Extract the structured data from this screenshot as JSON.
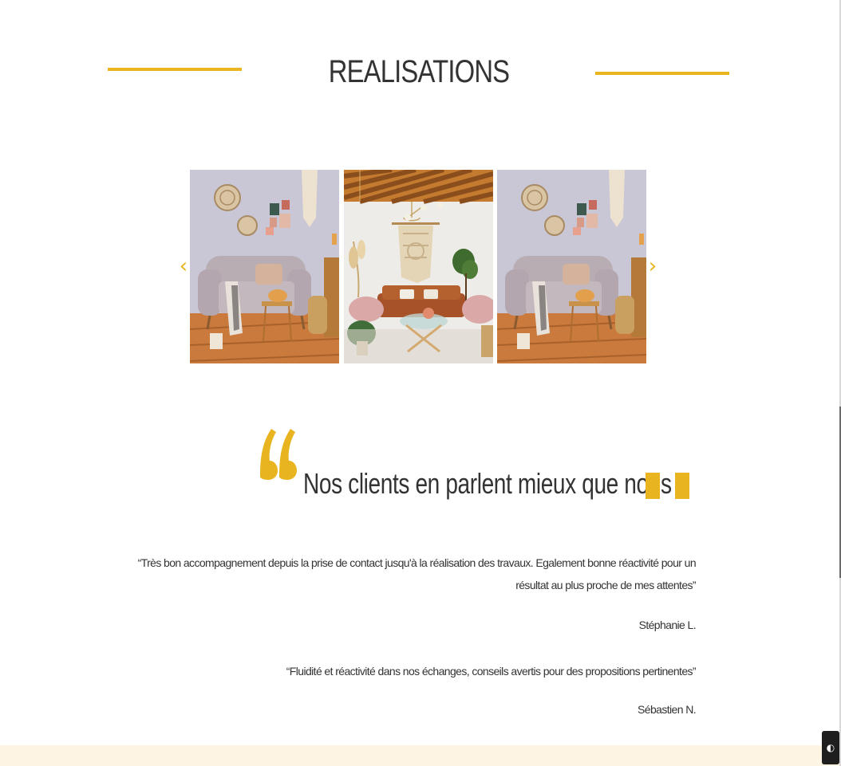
{
  "section": {
    "title": "REALISATIONS"
  },
  "carousel": {
    "prev_icon": "chevron-left-icon",
    "next_icon": "chevron-right-icon",
    "prev_glyph": "‹",
    "next_glyph": "›",
    "slides": [
      {
        "icon": "living-room-photo-1"
      },
      {
        "icon": "living-room-photo-2"
      },
      {
        "icon": "living-room-photo-3"
      }
    ]
  },
  "testimonials": {
    "quote_icon": "quote-mark-icon",
    "title": "Nos clients en parlent mieux que nous !",
    "items": [
      {
        "quote": "“Très bon accompagnement depuis la prise de contact jusqu'à la réalisation des travaux. Egalement bonne réactivité pour un résultat au plus proche de mes attentes”",
        "author": "Stéphanie L."
      },
      {
        "quote": "“Fluidité et réactivité dans nos échanges, conseils avertis pour des propositions pertinentes”",
        "author": "Sébastien N."
      }
    ]
  },
  "colors": {
    "accent": "#e8b520",
    "text": "#333333",
    "footer_bg": "#fdf4e3"
  },
  "widget": {
    "icon": "chat-widget-icon",
    "glyph": "◐"
  }
}
